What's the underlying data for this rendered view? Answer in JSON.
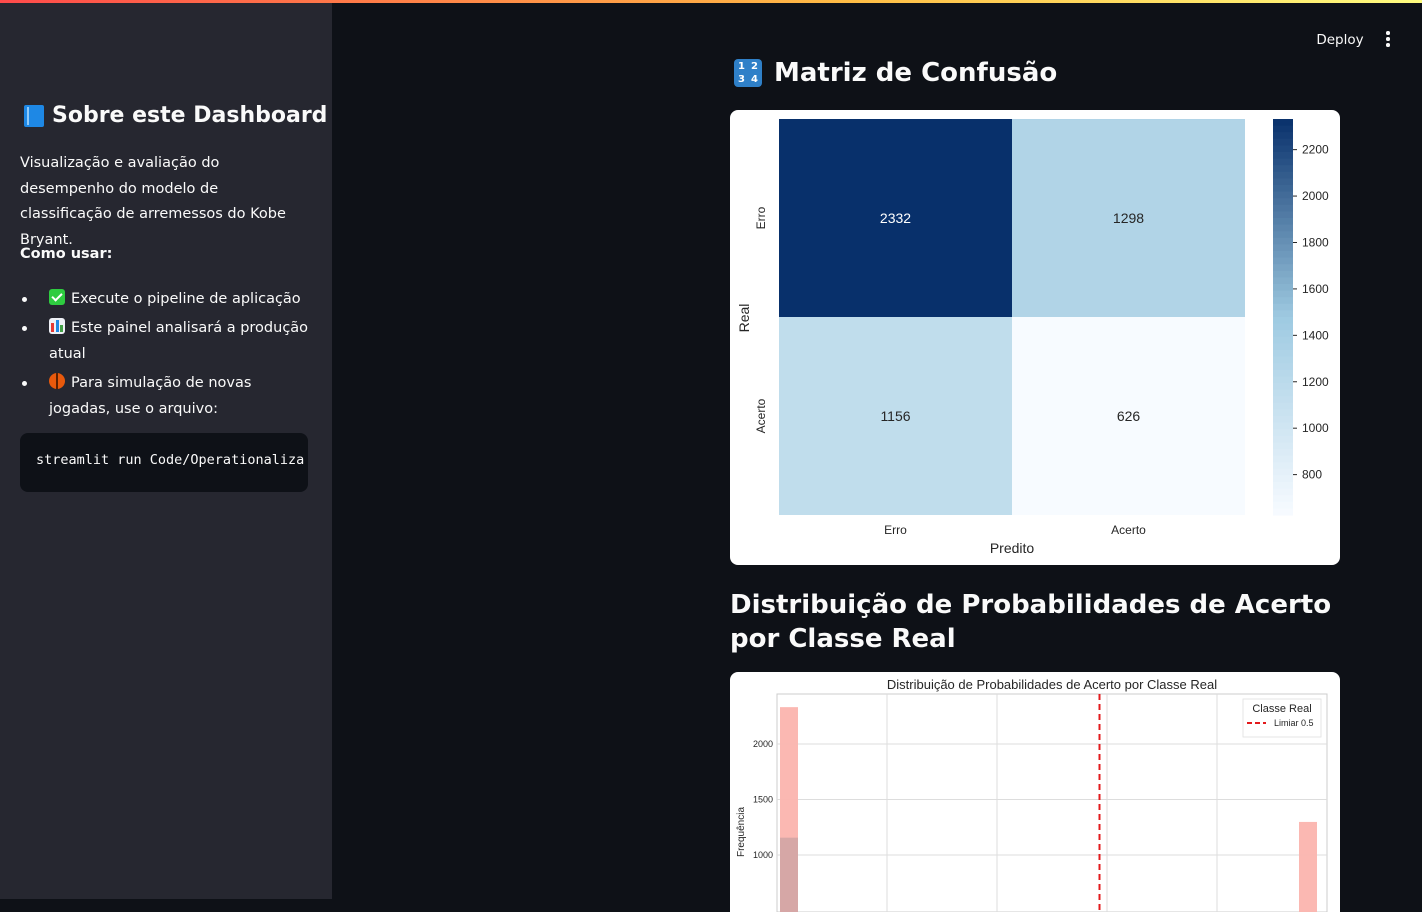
{
  "sidebar": {
    "title": "Sobre este Dashboard",
    "title_icon": "blue-book-icon",
    "description": "Visualização e avaliação do desempenho do modelo de classificação de arremessos do Kobe Bryant.",
    "howto_label": "Como usar:",
    "items": [
      {
        "icon": "check-mark-icon",
        "text": "Execute o pipeline de aplicação"
      },
      {
        "icon": "bar-chart-icon",
        "text": "Este painel analisará a produção atual"
      },
      {
        "icon": "basketball-icon",
        "text": "Para simulação de novas jogadas, use o arquivo:"
      }
    ],
    "code": "streamlit run Code/Operationaliza"
  },
  "header": {
    "deploy_label": "Deploy",
    "menu_icon": "vertical-dots-icon"
  },
  "main": {
    "confusion_heading": "Matriz de Confusão",
    "confusion_icon": "numbers-1234-icon",
    "numbers_icon_digits": [
      "1",
      "2",
      "3",
      "4"
    ],
    "distribution_heading": "Distribuição de Probabilidades de Acerto por Classe Real"
  },
  "chart_data": [
    {
      "type": "heatmap",
      "title": "",
      "xlabel": "Predito",
      "ylabel": "Real",
      "x_categories": [
        "Erro",
        "Acerto"
      ],
      "y_categories": [
        "Erro",
        "Acerto"
      ],
      "values": [
        [
          2332,
          1298
        ],
        [
          1156,
          626
        ]
      ],
      "colormap": "Blues",
      "colorbar_range": [
        626,
        2332
      ],
      "colorbar_ticks": [
        "800",
        "1000",
        "1200",
        "1400",
        "1600",
        "1800",
        "2000",
        "2200"
      ],
      "colors": {
        "low": "#f7fbff",
        "mid": "#9ecae1",
        "high": "#08306b"
      }
    },
    {
      "type": "bar",
      "title": "Distribuição de Probabilidades de Acerto por Classe Real",
      "xlabel": "",
      "ylabel": "Frequência",
      "y_ticks": [
        "1000",
        "1500",
        "2000"
      ],
      "ylim": [
        900,
        2400
      ],
      "xlim": [
        0,
        1
      ],
      "legend_title": "Classe Real",
      "legend_position": "top-right",
      "threshold": {
        "label": "Limiar 0.5",
        "x": 0.5,
        "color": "#e31a1c"
      },
      "bars": [
        {
          "x": 0.0,
          "height": 2332,
          "color": "#fbb4ae"
        },
        {
          "x": 0.0,
          "height": 1156,
          "color": "#d4a5a5"
        },
        {
          "x": 1.0,
          "height": 1298,
          "color": "#fbb4ae"
        }
      ],
      "grid": true
    }
  ]
}
